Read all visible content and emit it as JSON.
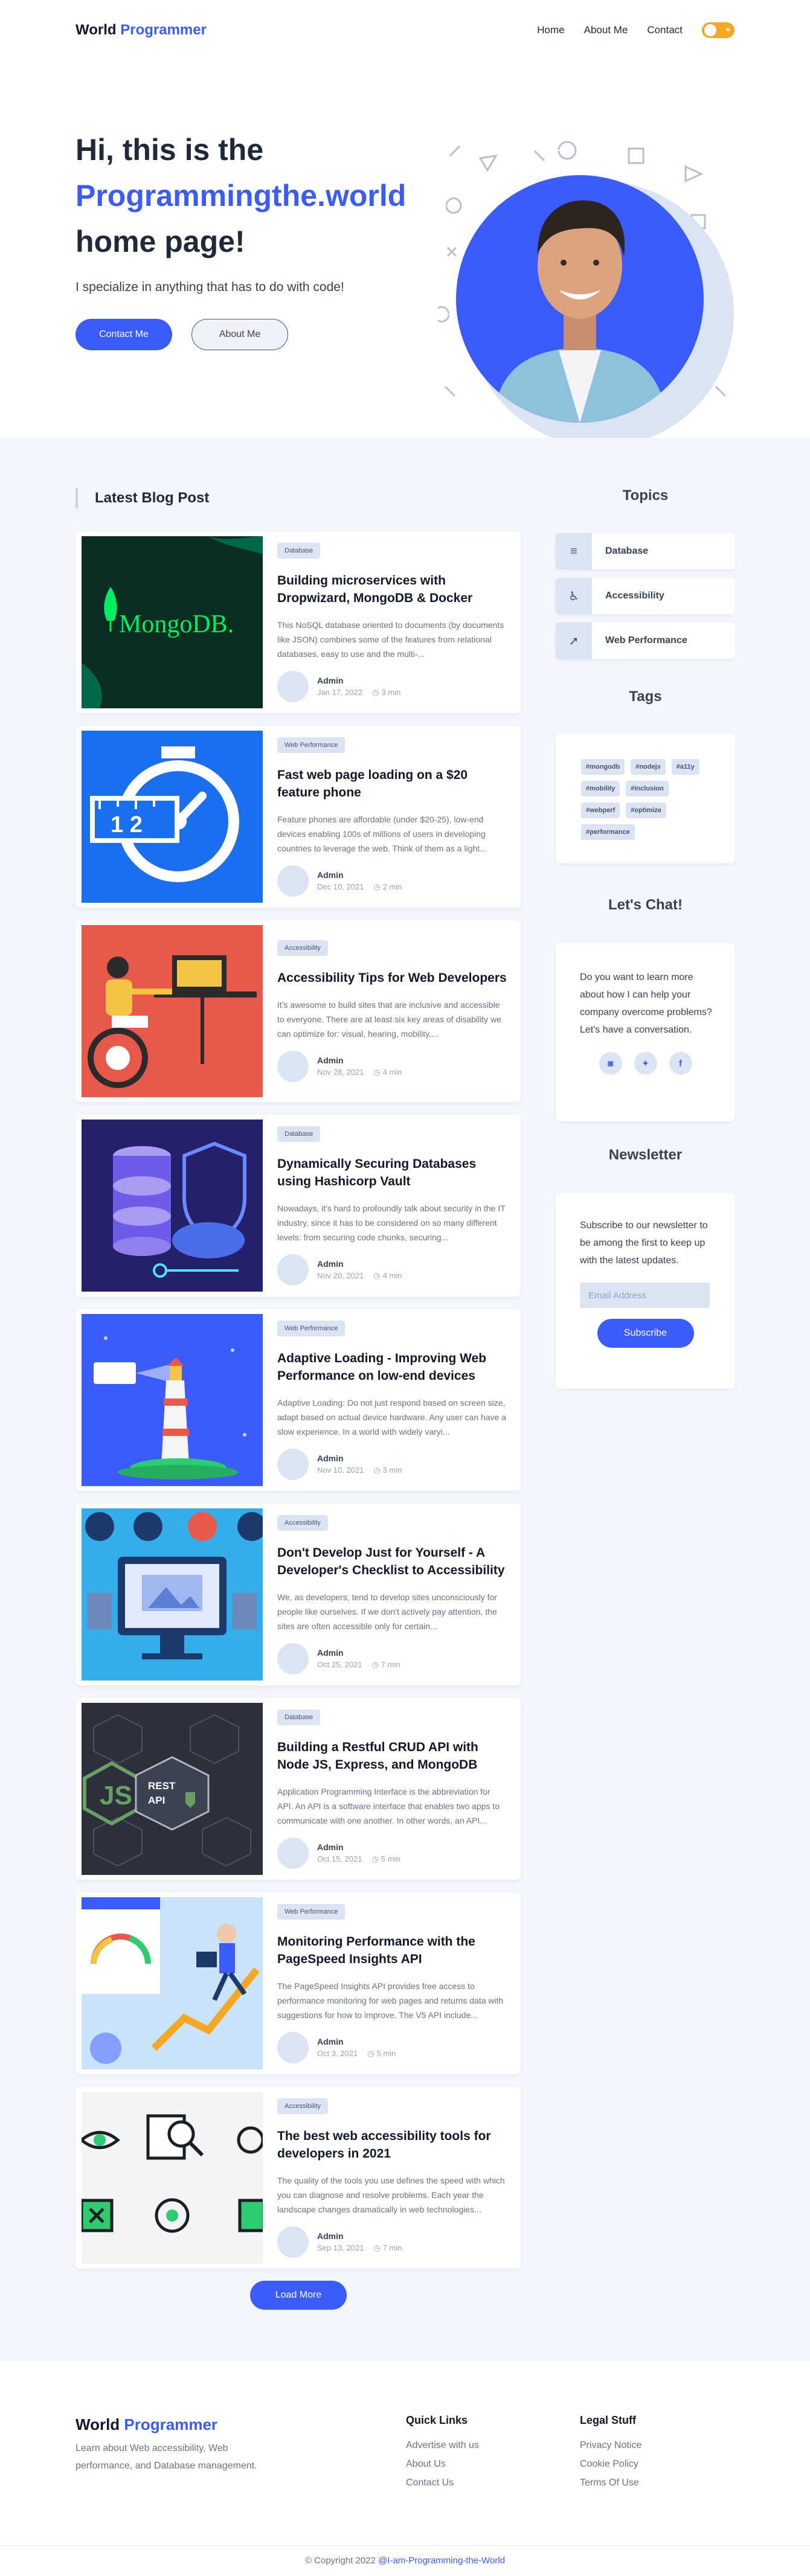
{
  "brand": {
    "first": "World",
    "second": "Programmer"
  },
  "nav": {
    "items": [
      "Home",
      "About Me",
      "Contact"
    ]
  },
  "hero": {
    "line1": "Hi, this is the",
    "line2": "Programmingthe.world",
    "line3": "home page!",
    "subtitle": "I specialize in anything that has to do with code!",
    "primary_button": "Contact Me",
    "secondary_button": "About Me"
  },
  "blog": {
    "section_title": "Latest Blog Post",
    "load_more": "Load More",
    "posts": [
      {
        "category": "Database",
        "title": "Building microservices with Dropwizard, MongoDB & Docker",
        "excerpt": "This NoSQL database oriented to documents (by documents like JSON) combines some of the features from relational databases, easy to use and the multi-...",
        "author": "Admin",
        "date": "Jan 17, 2022",
        "read_time": "3 min"
      },
      {
        "category": "Web Performance",
        "title": "Fast web page loading on a $20 feature phone",
        "excerpt": "Feature phones are affordable (under $20-25), low-end devices enabling 100s of millions of users in developing countries to leverage the web. Think of them as a light...",
        "author": "Admin",
        "date": "Dec 10, 2021",
        "read_time": "2 min"
      },
      {
        "category": "Accessibility",
        "title": "Accessibility Tips for Web Developers",
        "excerpt": "It's awesome to build sites that are inclusive and accessible to everyone. There are at least six key areas of disability we can optimize for: visual, hearing, mobility,...",
        "author": "Admin",
        "date": "Nov 28, 2021",
        "read_time": "4 min"
      },
      {
        "category": "Database",
        "title": "Dynamically Securing Databases using Hashicorp Vault",
        "excerpt": "Nowadays, it's hard to profoundly talk about security in the IT industry, since it has to be considered on so many different levels: from securing code chunks, securing...",
        "author": "Admin",
        "date": "Nov 20, 2021",
        "read_time": "4 min"
      },
      {
        "category": "Web Performance",
        "title": "Adaptive Loading - Improving Web Performance on low-end devices",
        "excerpt": "Adaptive Loading: Do not just respond based on screen size, adapt based on actual device hardware. Any user can have a slow experience. In a world with widely varyi...",
        "author": "Admin",
        "date": "Nov 10, 2021",
        "read_time": "3 min"
      },
      {
        "category": "Accessibility",
        "title": "Don't Develop Just for Yourself - A Developer's Checklist to Accessibility",
        "excerpt": "We, as developers, tend to develop sites unconsciously for people like ourselves. If we don't actively pay attention, the sites are often accessible only for certain...",
        "author": "Admin",
        "date": "Oct 25, 2021",
        "read_time": "7 min"
      },
      {
        "category": "Database",
        "title": "Building a Restful CRUD API with Node JS, Express, and MongoDB",
        "excerpt": "Application Programming Interface is the abbreviation for API. An API is a software interface that enables two apps to communicate with one another. In other words, an API...",
        "author": "Admin",
        "date": "Oct 15, 2021",
        "read_time": "5 min"
      },
      {
        "category": "Web Performance",
        "title": "Monitoring Performance with the PageSpeed Insights API",
        "excerpt": "The PageSpeed Insights API provides free access to performance monitoring for web pages and returns data with suggestions for how to improve. The V5 API include...",
        "author": "Admin",
        "date": "Oct 3, 2021",
        "read_time": "5 min"
      },
      {
        "category": "Accessibility",
        "title": "The best web accessibility tools for developers in 2021",
        "excerpt": "The quality of the tools you use defines the speed with which you can diagnose and resolve problems. Each year the landscape changes dramatically in web technologies...",
        "author": "Admin",
        "date": "Sep 13, 2021",
        "read_time": "7 min"
      }
    ],
    "thumb_texts": {
      "mongodb": "MongoDB.",
      "rest": "REST",
      "api": "API"
    }
  },
  "sidebar": {
    "topics_title": "Topics",
    "topics": [
      {
        "label": "Database",
        "icon": "database-icon"
      },
      {
        "label": "Accessibility",
        "icon": "accessibility-icon"
      },
      {
        "label": "Web Performance",
        "icon": "rocket-icon"
      }
    ],
    "tags_title": "Tags",
    "tags": [
      "#mongodb",
      "#nodejs",
      "#a11y",
      "#mobility",
      "#inclusion",
      "#webperf",
      "#optimize",
      "#performance"
    ],
    "chat_title": "Let's Chat!",
    "chat_text": "Do you want to learn more about how I can help your company overcome problems? Let's have a conversation.",
    "socials": [
      "discord-icon",
      "twitter-icon",
      "facebook-icon"
    ],
    "newsletter_title": "Newsletter",
    "newsletter_text": "Subscribe to our newsletter to be among the first to keep up with the latest updates.",
    "email_placeholder": "Email Address",
    "subscribe_button": "Subscribe"
  },
  "footer": {
    "description": "Learn about Web accessibility, Web performance, and Database management.",
    "quick_links_title": "Quick Links",
    "quick_links": [
      "Advertise with us",
      "About Us",
      "Contact Us"
    ],
    "legal_title": "Legal Stuff",
    "legal_links": [
      "Privacy Notice",
      "Cookie Policy",
      "Terms Of Use"
    ],
    "copyright_prefix": "© Copyright 2022",
    "copyright_link": "@I-am-Programming-the-World"
  },
  "colors": {
    "accent": "#3b5bfd",
    "toggle": "#f5a623",
    "section_bg": "#f3f7fd",
    "badge_bg": "#dbe4f3"
  }
}
